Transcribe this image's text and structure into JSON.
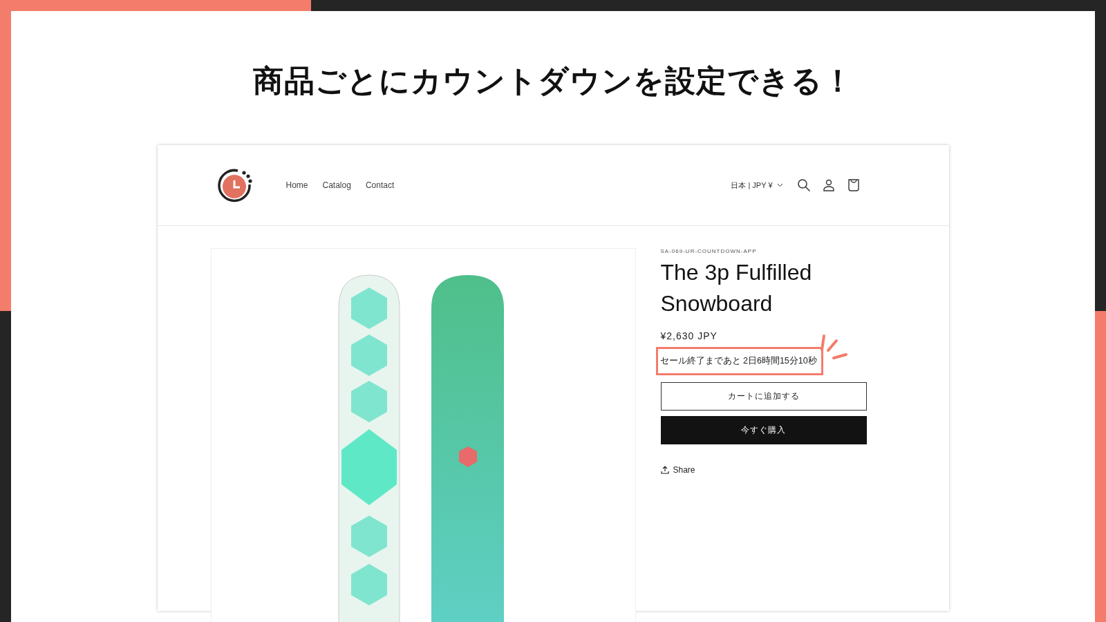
{
  "headline": "商品ごとにカウントダウンを設定できる！",
  "store": {
    "nav": [
      {
        "label": "Home"
      },
      {
        "label": "Catalog"
      },
      {
        "label": "Contact"
      }
    ],
    "locale": "日本 | JPY ¥"
  },
  "product": {
    "vendor": "SA-069-UR-COUNTDOWN-APP",
    "title": "The 3p Fulfilled Snowboard",
    "price": "¥2,630 JPY",
    "countdown": "セール終了まであと 2日6時間15分10秒",
    "buttons": [
      {
        "label": "カートに追加する",
        "kind": "outline"
      },
      {
        "label": "今すぐ購入",
        "kind": "solid"
      }
    ],
    "share": "Share"
  }
}
